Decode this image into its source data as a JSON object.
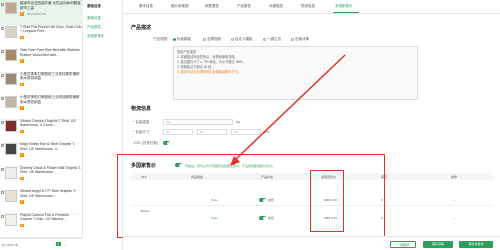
{
  "products": [
    {
      "title": "欧版乔治亚西装外套·女性运动休闲服装超市工装",
      "badge": "",
      "num": "SPZH0037781",
      "thumb": "#bfa98e"
    },
    {
      "title": "T-Shirt Flat Round Hat Clips, Solid Colo + Leopard Print...",
      "badge": "",
      "num": "",
      "thumb": "#d9d2c7"
    },
    {
      "title": "Twin Over Twin Size Bed with Shelves, Rubber Wood Bed with...",
      "badge": "",
      "num": "",
      "thumb": "#a88b6a"
    },
    {
      "title": "小型花饰彩灯家庭用工业风加厚防潮耐用木质收纳盒",
      "badge": "",
      "num": "",
      "thumb": "#9c8a76"
    },
    {
      "title": "小型花饰彩灯家庭用工业风加厚防潮耐用木质收纳盒",
      "badge": "",
      "num": "",
      "thumb": "#c4b7a6"
    },
    {
      "title": "Vibrant Cartoon Graphic T-Shirt, US Warehouse, 4 Colors...",
      "badge": "",
      "num": "",
      "thumb": "#7a2e2e"
    },
    {
      "title": "Edgy Gothic Eye & Skull Graphic T-Shirt, US Warehouse, 4...",
      "badge": "",
      "num": "",
      "thumb": "#444"
    },
    {
      "title": "Dreamy Cloud & Flower Nail Graphic T-Shirt, US Warehouse...",
      "badge": "",
      "num": "",
      "thumb": "#eee"
    },
    {
      "title": "Vibrant Angel & 777 Dice Graphic T-Shirt, US Warehouse...",
      "badge": "",
      "num": "",
      "thumb": "#e8e2d0"
    },
    {
      "title": "Playful Cartoon Fan & Freedom Graphic T-Shirt, US Wareho...",
      "badge": "",
      "num": "",
      "thumb": "#f0efe9"
    }
  ],
  "pager": {
    "total": "共 12397 条",
    "prev": "‹",
    "page": "1",
    "next": "›"
  },
  "nav": {
    "title": "基础信息",
    "items": [
      "基础信息",
      "产品属性",
      "多国家售价"
    ]
  },
  "tabs": [
    "基本信息",
    "图片和视频",
    "销售属性",
    "产品属性",
    "详细描述",
    "物流信息",
    "多国家售价"
  ],
  "product_info": {
    "section": "产品描述",
    "desc_label": "产品视图：",
    "radios": [
      "标准模板",
      "全屏视频",
      "自定义模板",
      "一键主页",
      "旧版详情"
    ],
    "hint_lines": [
      "提供产品描述：",
      "1. 详细描述商品的特点，优势和使用场景。",
      "2. 建议图片尺寸 ≥ 750 像素，大小不超过 3MB。",
      "3. 视频建议不超过 60 秒。",
      "4. 描述中请勿出现其他平台链接或联系方式。"
    ]
  },
  "stock": {
    "section": "物流信息",
    "rows": [
      {
        "label": "* 包装重量",
        "value": "0.5",
        "unit": "kg"
      },
      {
        "label": "* 包装尺寸",
        "value": "10",
        "unit": "cm"
      }
    ],
    "toggle_label": "COD (货到付款)"
  },
  "multi_price": {
    "section": "多国家售价",
    "hint": "开启后，您可以为不同国家设置独立售价，不设置则使用默认售价。",
    "columns": [
      "SKU",
      "商品规格",
      "产品状态",
      "多国家售价",
      "库存",
      "操作"
    ],
    "rows": [
      {
        "sku": "Brown",
        "spec": "Style",
        "status": "在售",
        "price": "MXN 0.00",
        "stock": "0",
        "action": "--"
      },
      {
        "sku": "",
        "spec": "Style",
        "status": "在售",
        "price": "GBP 0.43",
        "stock": "0",
        "action": "--"
      }
    ]
  },
  "footer": {
    "save_draft": "一键翻译",
    "save": "保存草稿",
    "publish": "保存并发布"
  }
}
